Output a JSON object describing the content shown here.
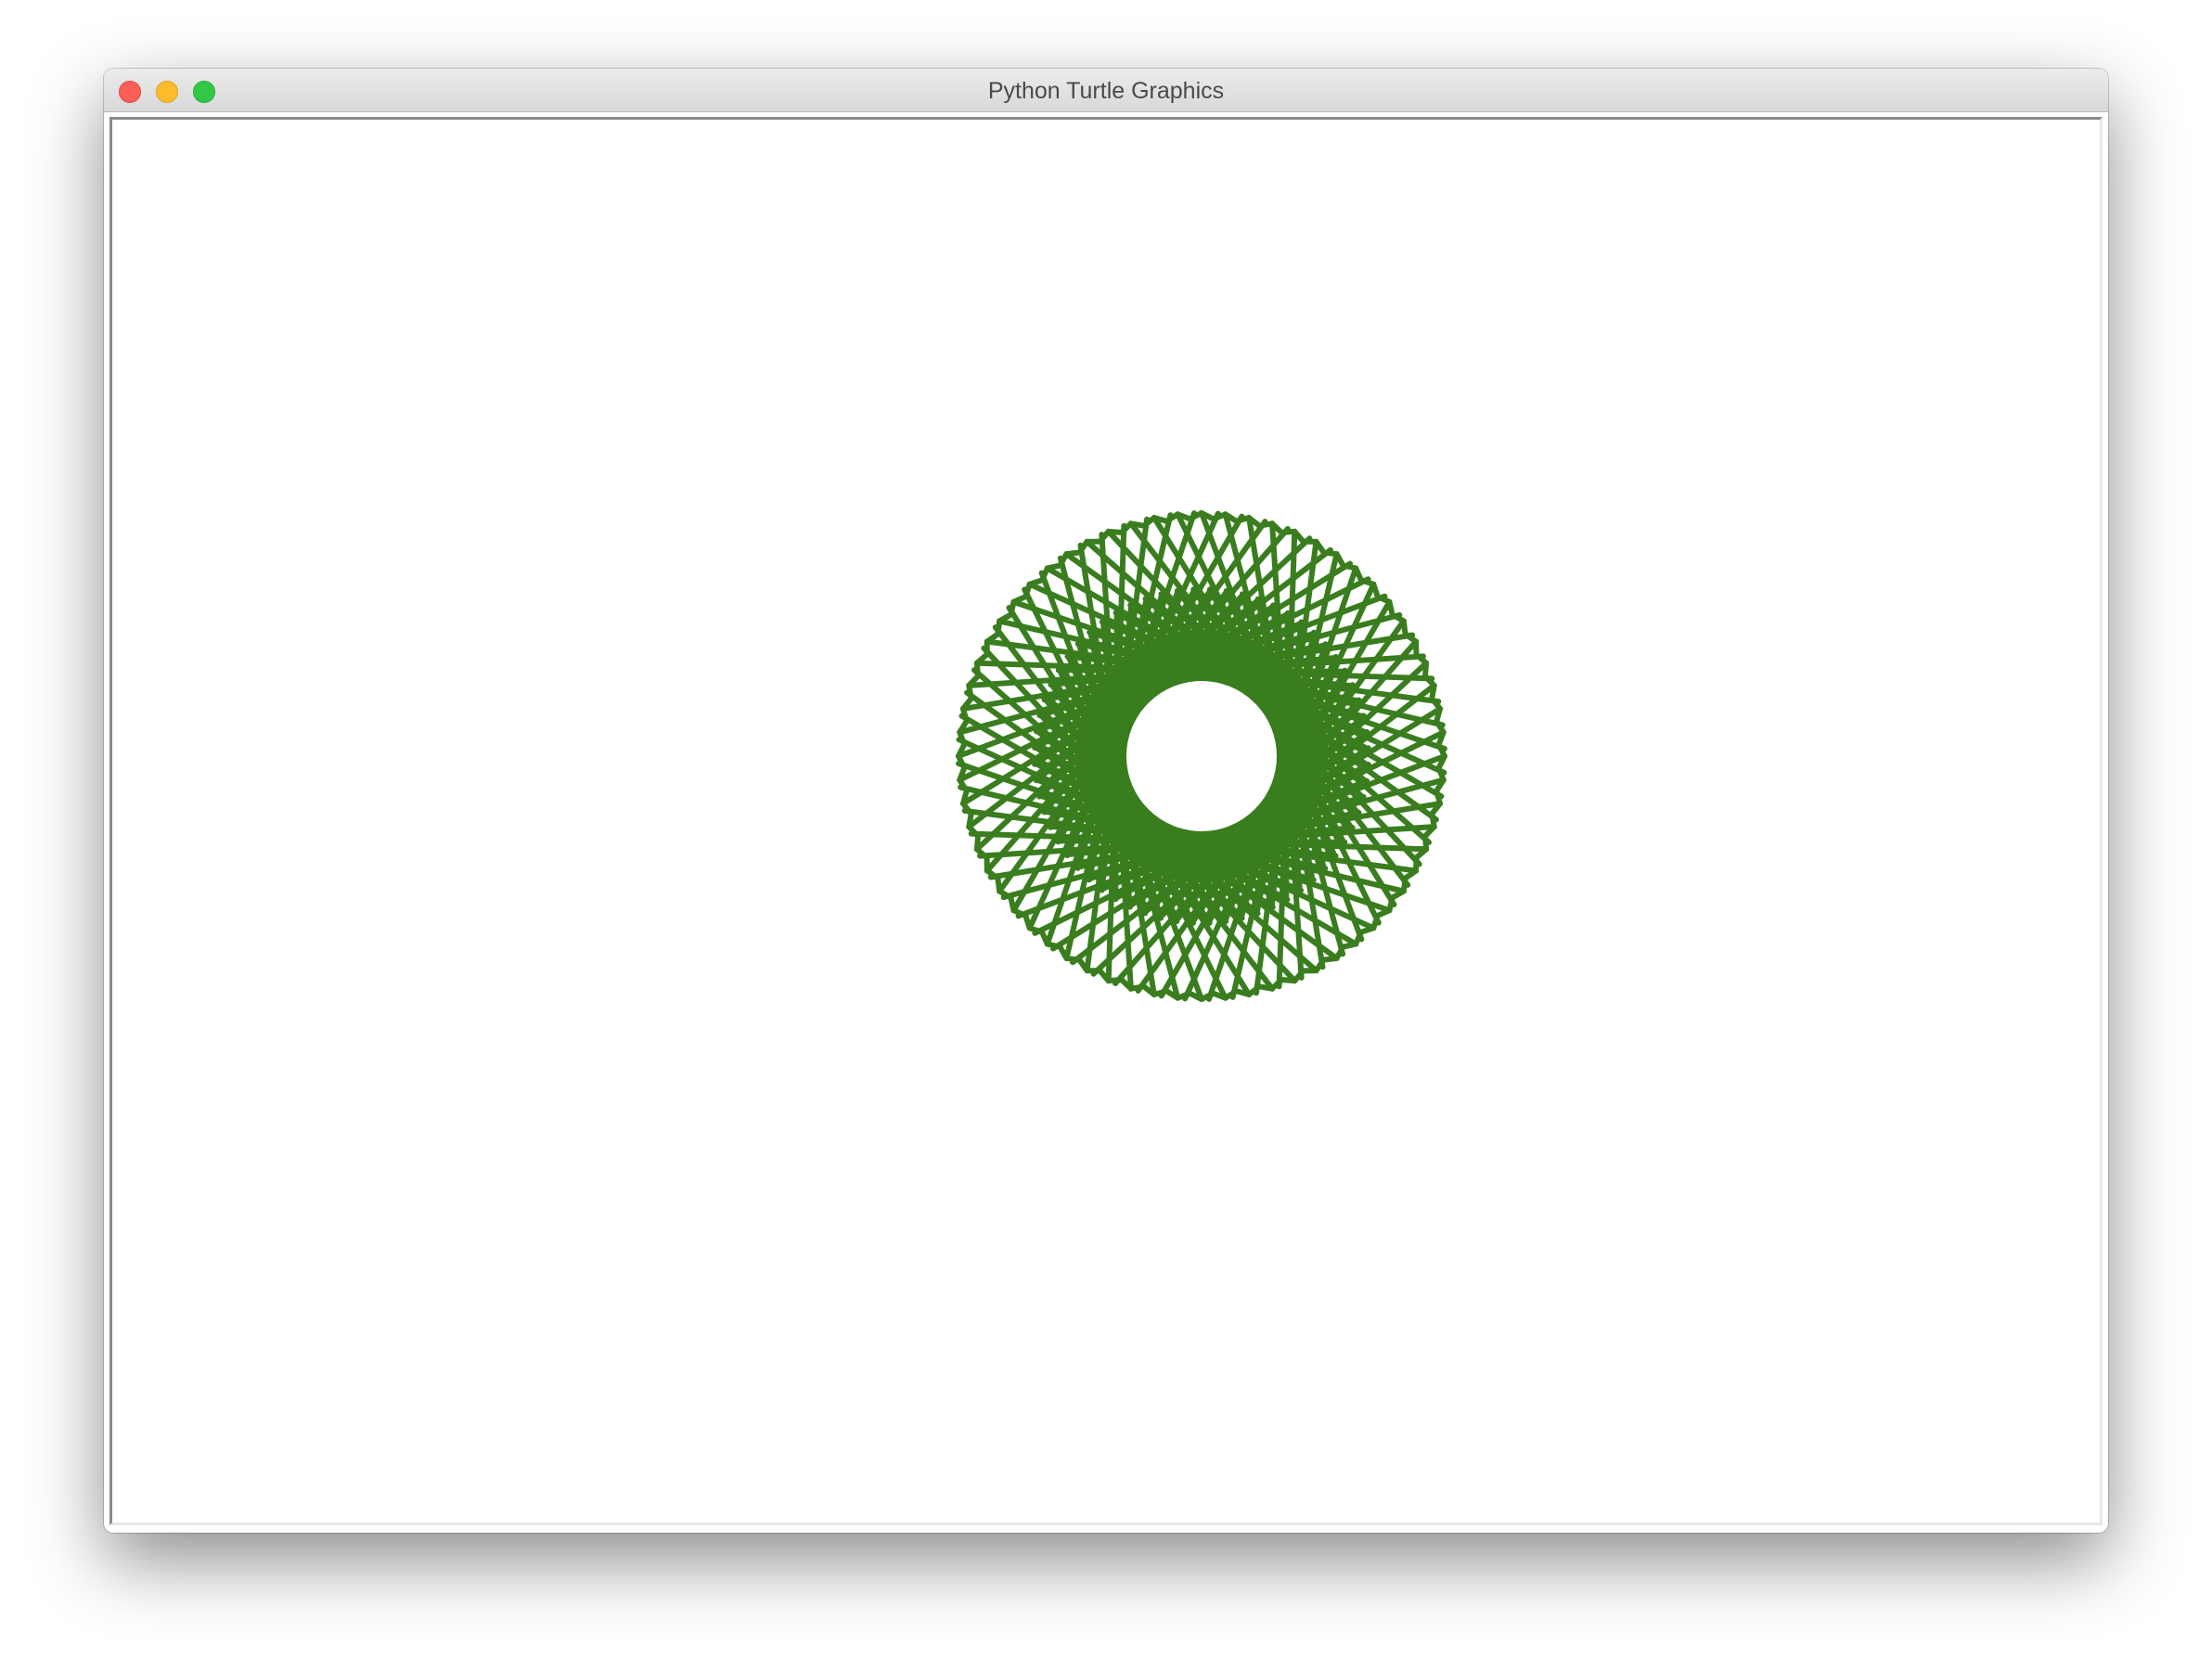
{
  "window": {
    "title": "Python Turtle Graphics"
  },
  "icons": {
    "close": "close-button-icon",
    "minimize": "minimize-button-icon",
    "zoom": "zoom-button-icon"
  },
  "colors": {
    "pen": "#3a7d1f",
    "canvas_background": "#ffffff",
    "close": "#fc5f57",
    "minimize": "#fdbc2e",
    "zoom": "#33c748"
  },
  "drawing": {
    "shape": "spirograph"
  }
}
